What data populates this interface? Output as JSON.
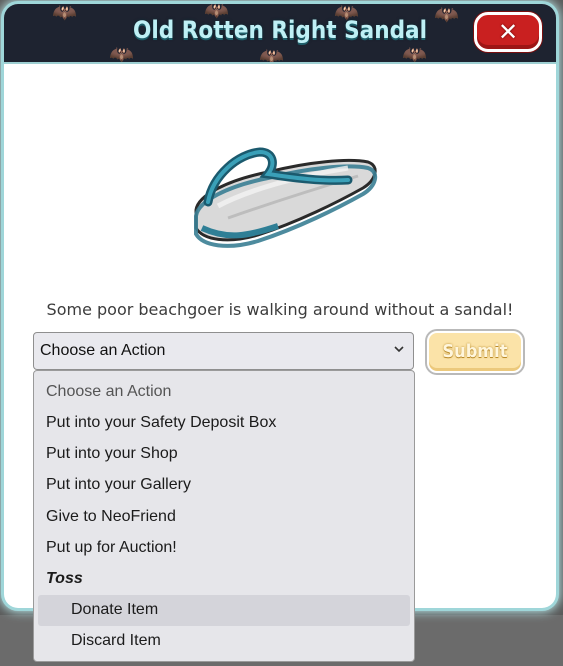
{
  "modal": {
    "title": "Old Rotten Right Sandal",
    "close_symbol": "✕",
    "description": "Some poor beachgoer is walking around without a sandal!",
    "item_image_icon": "sandal-image"
  },
  "action_select": {
    "value": "Choose an Action",
    "options": [
      "Choose an Action",
      "Put into your Safety Deposit Box",
      "Put into your Shop",
      "Put into your Gallery",
      "Give to NeoFriend",
      "Put up for Auction!"
    ],
    "group_label": "Toss",
    "group_options": [
      "Donate Item",
      "Discard Item"
    ],
    "highlighted_option": "Donate Item"
  },
  "submit_label": "Submit",
  "colors": {
    "header_bg": "#1e2330",
    "title_text": "#bff0f5",
    "close_button": "#c92020",
    "submit_button": "#fbe3a8",
    "modal_glow": "#9fd6d9"
  }
}
